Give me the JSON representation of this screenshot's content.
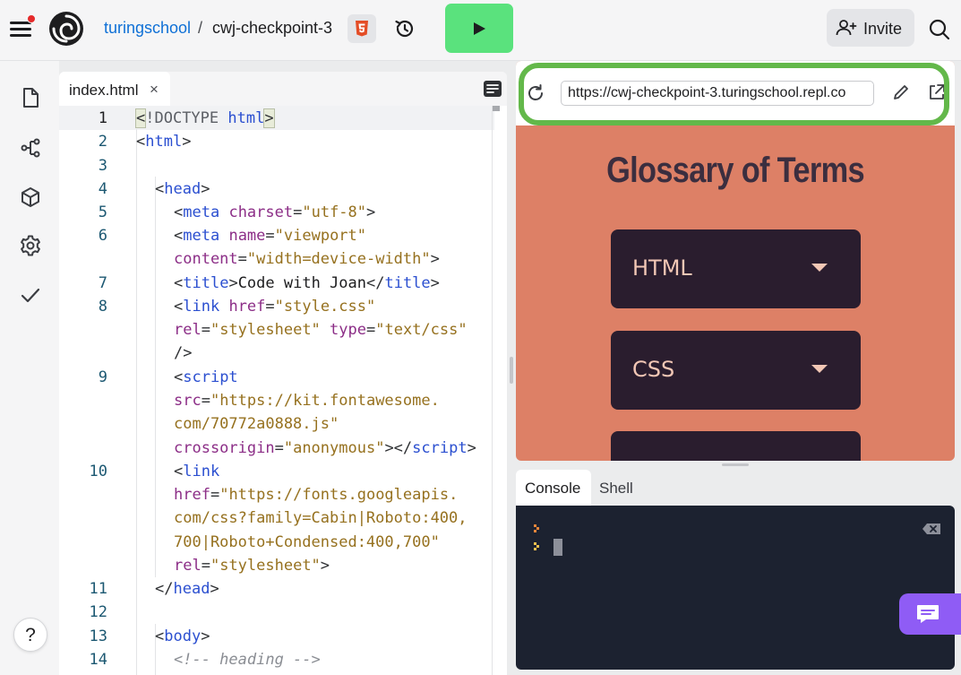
{
  "topbar": {
    "team": "turingschool",
    "separator": "/",
    "repl_name": "cwj-checkpoint-3",
    "invite_label": "Invite"
  },
  "editor": {
    "tab_name": "index.html",
    "tab_close": "×",
    "line_numbers": [
      "1",
      "2",
      "3",
      "4",
      "5",
      "6",
      "7",
      "8",
      "9",
      "10",
      "11",
      "12",
      "13",
      "14"
    ]
  },
  "webview": {
    "url": "https://cwj-checkpoint-3.turingschool.repl.co",
    "heading": "Glossary of Terms",
    "accordion_items": [
      "HTML",
      "CSS"
    ],
    "colors": {
      "page_bg": "#dd8066",
      "accordion_bg": "#2a1d2e",
      "accordion_text": "#f2c7b5",
      "url_highlight": "#63b84a"
    }
  },
  "console": {
    "tabs": [
      "Console",
      "Shell"
    ]
  },
  "help_label": "?",
  "colors": {
    "run_button": "#5ae27d",
    "link": "#0f70d6",
    "console_bg": "#1c2230",
    "chat_button": "#8f5cf5"
  },
  "icons": [
    "hamburger-icon",
    "replit-logo",
    "html5-icon",
    "history-icon",
    "play-icon",
    "add-person-icon",
    "search-icon",
    "file-icon",
    "git-icon",
    "package-icon",
    "settings-icon",
    "check-icon",
    "refresh-icon",
    "pencil-icon",
    "external-link-icon",
    "backspace-icon",
    "chat-icon"
  ]
}
